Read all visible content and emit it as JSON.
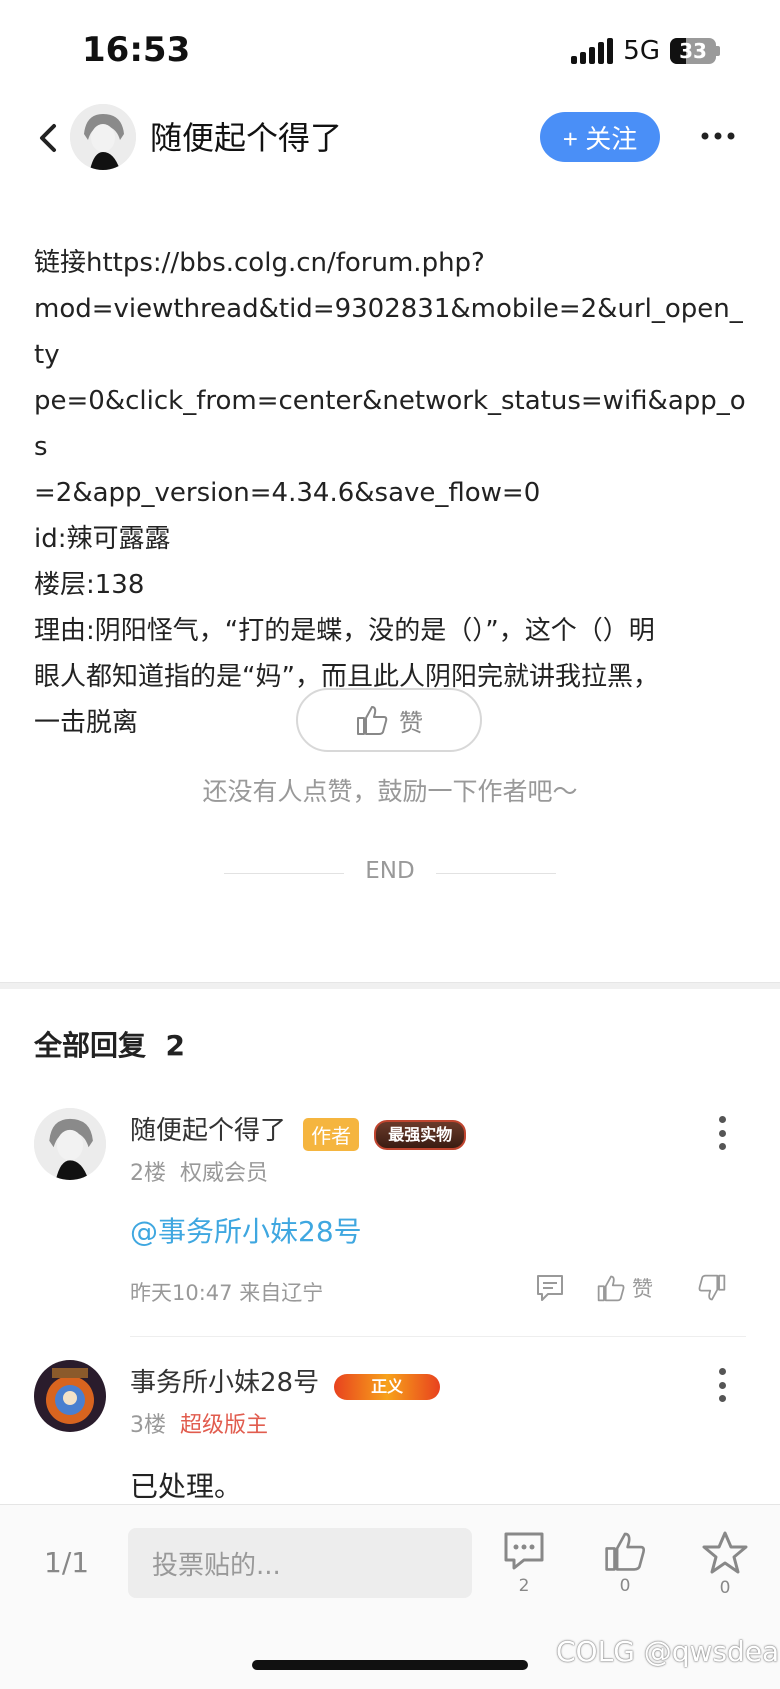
{
  "status_bar": {
    "time": "16:53",
    "network": "5G",
    "battery": "33"
  },
  "header": {
    "username": "随便起个得了",
    "follow_label": "+ 关注"
  },
  "post": {
    "lines": [
      "链接https://bbs.colg.cn/forum.php?",
      "mod=viewthread&tid=9302831&mobile=2&url_open_ty",
      "pe=0&click_from=center&network_status=wifi&app_os",
      "=2&app_version=4.34.6&save_flow=0",
      "id:辣可露露",
      "楼层:138",
      "理由:阴阳怪气，“打的是蝶，没的是（）”，这个（）明",
      "眼人都知道指的是“妈”，而且此人阴阳完就讲我拉黑，",
      "一击脱离"
    ],
    "like_label": "赞",
    "like_hint": "还没有人点赞，鼓励一下作者吧～",
    "end_label": "END"
  },
  "replies_section": {
    "title": "全部回复",
    "count": "2",
    "replies": [
      {
        "name": "随便起个得了",
        "tag": "作者",
        "medal": "最强实物",
        "floor": "2楼",
        "role": "权威会员",
        "content": "@事务所小妹28号",
        "time": "昨天10:47 来自辽宁",
        "like_label": "赞"
      },
      {
        "name": "事务所小妹28号",
        "medal": "正义",
        "floor": "3楼",
        "role": "超级版主",
        "content": "已处理。"
      }
    ]
  },
  "bottom_bar": {
    "page": "1/1",
    "input_placeholder": "投票贴的...",
    "comment_count": "2",
    "like_count": "0",
    "favorite_count": "0"
  },
  "watermark": "COLG @qwsdea",
  "colors": {
    "accent": "#4a8ff7",
    "mention": "#3fa7e0",
    "author_tag": "#f5b53f",
    "role_red": "#e15c4e"
  }
}
